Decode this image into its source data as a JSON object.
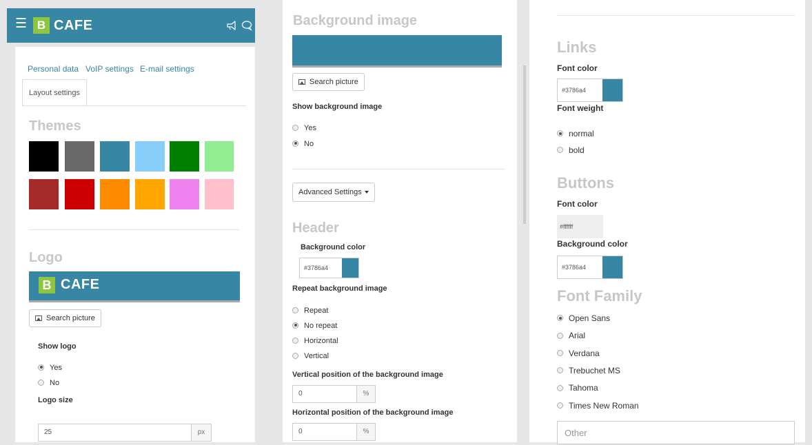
{
  "header": {
    "brand_letter": "B",
    "brand_name": "CAFE",
    "menu_icon": "hamburger-icon",
    "megaphone_icon": "megaphone-icon",
    "chat_icon": "chat-icon"
  },
  "tabs": {
    "personal": "Personal data",
    "voip": "VoIP settings",
    "email": "E-mail settings",
    "layout": "Layout settings"
  },
  "themes": {
    "title": "Themes",
    "colors": [
      "#000000",
      "#696969",
      "#3786a4",
      "#87cefa",
      "#008000",
      "#90ee90",
      "#a52a2a",
      "#cc0000",
      "#ff8c00",
      "#ffa500",
      "#ee82ee",
      "#ffc0cb"
    ]
  },
  "logo": {
    "title": "Logo",
    "preview_letter": "B",
    "preview_name": "CAFE",
    "search_button": "Search picture",
    "show_label": "Show logo",
    "options": [
      "Yes",
      "No"
    ],
    "selected": "Yes",
    "size_label": "Logo size",
    "size_value": "25",
    "size_unit": "px"
  },
  "background_image": {
    "title": "Background image",
    "search_button": "Search picture",
    "show_label": "Show background image",
    "options": [
      "Yes",
      "No"
    ],
    "selected": "No"
  },
  "advanced": {
    "button": "Advanced Settings"
  },
  "header_section": {
    "title": "Header",
    "bg_color_label": "Background color",
    "bg_color_value": "#3786a4",
    "repeat_label": "Repeat background image",
    "repeat_options": [
      "Repeat",
      "No repeat",
      "Horizontal",
      "Vertical"
    ],
    "repeat_selected": "No repeat",
    "vertical_label": "Vertical position of the background image",
    "vertical_value": "0",
    "horizontal_label": "Horizontal position of the background image",
    "horizontal_value": "0",
    "unit": "%"
  },
  "links": {
    "title": "Links",
    "font_color_label": "Font color",
    "font_color_value": "#3786a4",
    "font_weight_label": "Font weight",
    "weight_options": [
      "normal",
      "bold"
    ],
    "weight_selected": "normal"
  },
  "buttons": {
    "title": "Buttons",
    "font_color_label": "Font color",
    "font_color_value": "#ffffff",
    "bg_color_label": "Background color",
    "bg_color_value": "#3786a4"
  },
  "font_family": {
    "title": "Font Family",
    "options": [
      "Open Sans",
      "Arial",
      "Verdana",
      "Trebuchet MS",
      "Tahoma",
      "Times New Roman"
    ],
    "selected": "Open Sans",
    "other_placeholder": "Other"
  },
  "colors": {
    "accent": "#3786a4",
    "brand_green": "#8dc63f"
  }
}
